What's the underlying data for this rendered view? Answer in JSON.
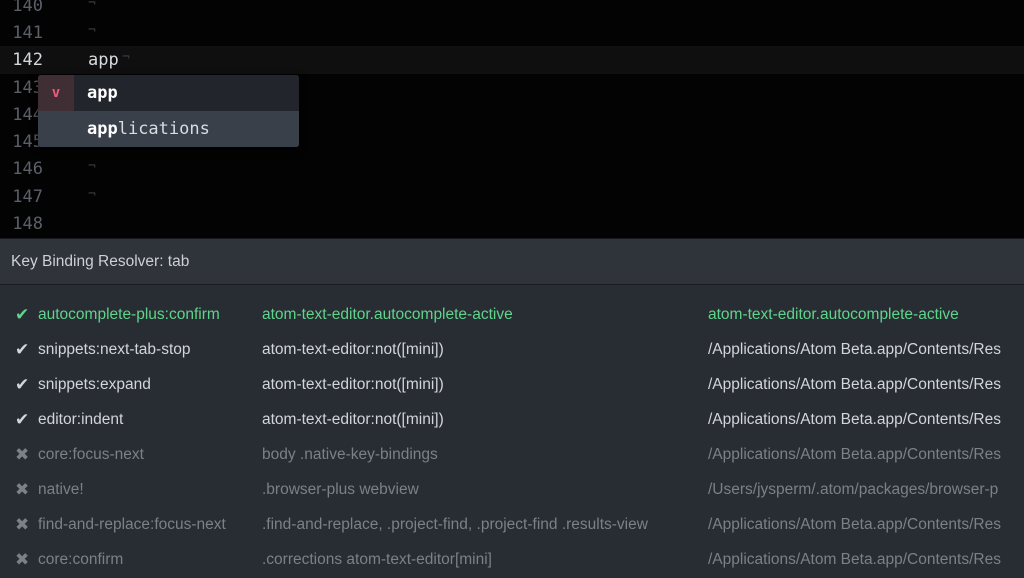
{
  "editor": {
    "eol_glyph": "¬",
    "lines": [
      {
        "number": "140",
        "text": ""
      },
      {
        "number": "141",
        "text": ""
      },
      {
        "number": "142",
        "text": "app"
      },
      {
        "number": "143",
        "text": ""
      },
      {
        "number": "144",
        "text": ""
      },
      {
        "number": "145",
        "text": ""
      },
      {
        "number": "146",
        "text": ""
      },
      {
        "number": "147",
        "text": ""
      },
      {
        "number": "148",
        "text": ""
      }
    ]
  },
  "autocomplete": {
    "suggestions": [
      {
        "type_badge": "v",
        "match": "app",
        "rest": ""
      },
      {
        "type_badge": "",
        "match": "app",
        "rest": "lications"
      }
    ]
  },
  "resolver": {
    "title": "Key Binding Resolver: tab",
    "bindings": [
      {
        "status": "used",
        "icon": "check-icon",
        "command": "autocomplete-plus:confirm",
        "selector": "atom-text-editor.autocomplete-active",
        "source": "atom-text-editor.autocomplete-active"
      },
      {
        "status": "unused",
        "icon": "check-icon",
        "command": "snippets:next-tab-stop",
        "selector": "atom-text-editor:not([mini])",
        "source": "/Applications/Atom Beta.app/Contents/Res"
      },
      {
        "status": "unused",
        "icon": "check-icon",
        "command": "snippets:expand",
        "selector": "atom-text-editor:not([mini])",
        "source": "/Applications/Atom Beta.app/Contents/Res"
      },
      {
        "status": "unused",
        "icon": "check-icon",
        "command": "editor:indent",
        "selector": "atom-text-editor:not([mini])",
        "source": "/Applications/Atom Beta.app/Contents/Res"
      },
      {
        "status": "unmatched",
        "icon": "cross-icon",
        "command": "core:focus-next",
        "selector": "body .native-key-bindings",
        "source": "/Applications/Atom Beta.app/Contents/Res"
      },
      {
        "status": "unmatched",
        "icon": "cross-icon",
        "command": "native!",
        "selector": ".browser-plus webview",
        "source": "/Users/jysperm/.atom/packages/browser-p"
      },
      {
        "status": "unmatched",
        "icon": "cross-icon",
        "command": "find-and-replace:focus-next",
        "selector": ".find-and-replace, .project-find, .project-find .results-view",
        "source": "/Applications/Atom Beta.app/Contents/Res"
      },
      {
        "status": "unmatched",
        "icon": "cross-icon",
        "command": "core:confirm",
        "selector": ".corrections atom-text-editor[mini]",
        "source": "/Applications/Atom Beta.app/Contents/Res"
      }
    ]
  },
  "colors": {
    "used": "#5fd48a",
    "unused": "#d2d5da",
    "unmatched": "#7b8089",
    "badge_variable": "#ee5c7a"
  }
}
